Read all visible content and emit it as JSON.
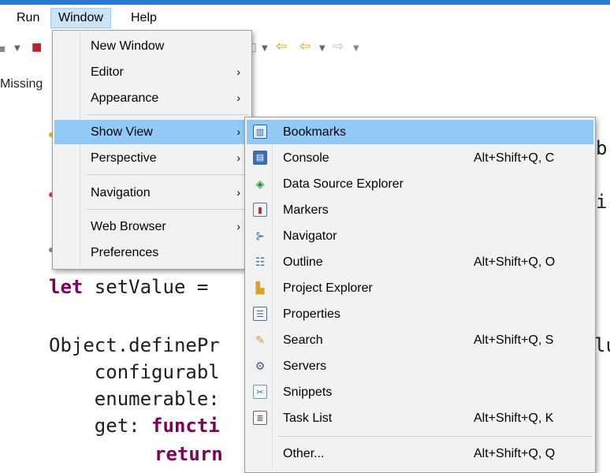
{
  "menubar": {
    "items": [
      "Run",
      "Window",
      "Help"
    ]
  },
  "status": {
    "missing_text": "Missing"
  },
  "code": {
    "line_let": "let",
    "line_setvalue": " setValue = ",
    "line_object": "Object.definePr",
    "line_configurable": "    configurabl",
    "line_enumerable": "    enumerable:",
    "line_get": "    get: ",
    "line_get_kw": "functi",
    "line_return_kw": "return",
    "right_fragment_1": "b",
    "right_fragment_2": "i",
    "right_fragment_3": "lu"
  },
  "window_menu": {
    "items": [
      {
        "label": "New Window",
        "submenu": false
      },
      {
        "label": "Editor",
        "submenu": true
      },
      {
        "label": "Appearance",
        "submenu": true
      },
      {
        "label": "Show View",
        "submenu": true
      },
      {
        "label": "Perspective",
        "submenu": true
      },
      {
        "label": "Navigation",
        "submenu": true
      },
      {
        "label": "Web Browser",
        "submenu": true
      },
      {
        "label": "Preferences",
        "submenu": false
      }
    ],
    "arrow_glyph": "›"
  },
  "show_view_menu": {
    "items": [
      {
        "label": "Bookmarks",
        "shortcut": "",
        "icon": "bookmarks-icon"
      },
      {
        "label": "Console",
        "shortcut": "Alt+Shift+Q, C",
        "icon": "console-icon"
      },
      {
        "label": "Data Source Explorer",
        "shortcut": "",
        "icon": "data-source-explorer-icon"
      },
      {
        "label": "Markers",
        "shortcut": "",
        "icon": "markers-icon"
      },
      {
        "label": "Navigator",
        "shortcut": "",
        "icon": "navigator-icon"
      },
      {
        "label": "Outline",
        "shortcut": "Alt+Shift+Q, O",
        "icon": "outline-icon"
      },
      {
        "label": "Project Explorer",
        "shortcut": "",
        "icon": "project-explorer-icon"
      },
      {
        "label": "Properties",
        "shortcut": "",
        "icon": "properties-icon"
      },
      {
        "label": "Search",
        "shortcut": "Alt+Shift+Q, S",
        "icon": "search-icon"
      },
      {
        "label": "Servers",
        "shortcut": "",
        "icon": "servers-icon"
      },
      {
        "label": "Snippets",
        "shortcut": "",
        "icon": "snippets-icon"
      },
      {
        "label": "Task List",
        "shortcut": "Alt+Shift+Q, K",
        "icon": "task-list-icon"
      },
      {
        "label": "Other...",
        "shortcut": "Alt+Shift+Q, Q",
        "icon": ""
      }
    ]
  },
  "colors": {
    "highlight": "#91c9f7",
    "menu_bg": "#f2f2f2",
    "keyword": "#7f0055"
  }
}
